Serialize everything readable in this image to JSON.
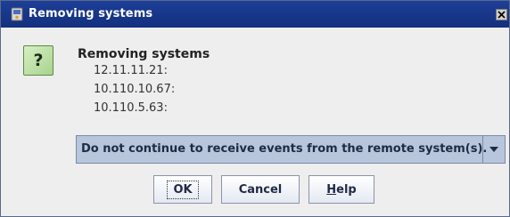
{
  "window": {
    "title": "Removing systems",
    "icon": "app-window-icon",
    "close_label": "✕"
  },
  "message": {
    "icon": "question-icon",
    "icon_glyph": "?",
    "heading": "Removing systems",
    "systems": [
      "12.11.11.21:",
      "10.110.10.67:",
      "10.110.5.63:"
    ]
  },
  "option": {
    "selected": "Do not continue to receive events from the remote system(s)."
  },
  "buttons": {
    "ok": "OK",
    "cancel": "Cancel",
    "help_mnemonic": "H",
    "help_rest": "elp"
  },
  "colors": {
    "titlebar": "#1a3a8e",
    "combo_background": "#b8c6dc",
    "question_icon": "#a8d38d"
  }
}
